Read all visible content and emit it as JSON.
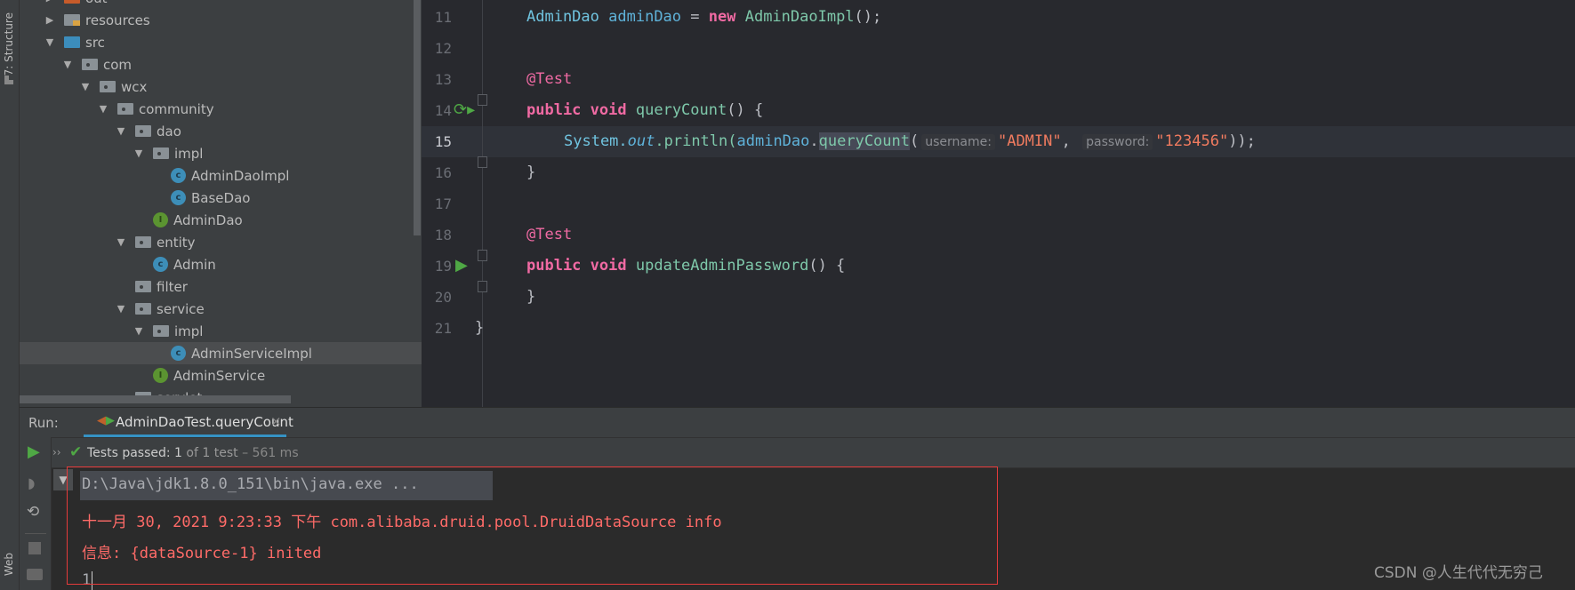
{
  "left_stripe": {
    "structure": "7: Structure",
    "web": "Web"
  },
  "tree": {
    "items": [
      {
        "label": "out",
        "depth": 1,
        "arrow": "collapsed",
        "icon": "folder-out-icon"
      },
      {
        "label": "resources",
        "depth": 1,
        "arrow": "collapsed",
        "icon": "resources-folder-icon"
      },
      {
        "label": "src",
        "depth": 1,
        "arrow": "expanded",
        "icon": "source-folder-icon"
      },
      {
        "label": "com",
        "depth": 2,
        "arrow": "expanded",
        "icon": "package-icon"
      },
      {
        "label": "wcx",
        "depth": 3,
        "arrow": "expanded",
        "icon": "package-icon"
      },
      {
        "label": "community",
        "depth": 4,
        "arrow": "expanded",
        "icon": "package-icon"
      },
      {
        "label": "dao",
        "depth": 5,
        "arrow": "expanded",
        "icon": "package-icon"
      },
      {
        "label": "impl",
        "depth": 6,
        "arrow": "expanded",
        "icon": "package-icon"
      },
      {
        "label": "AdminDaoImpl",
        "depth": 7,
        "arrow": "none",
        "icon": "class-icon"
      },
      {
        "label": "BaseDao",
        "depth": 7,
        "arrow": "none",
        "icon": "abstract-class-icon"
      },
      {
        "label": "AdminDao",
        "depth": 6,
        "arrow": "none",
        "icon": "interface-icon"
      },
      {
        "label": "entity",
        "depth": 5,
        "arrow": "expanded",
        "icon": "package-icon"
      },
      {
        "label": "Admin",
        "depth": 6,
        "arrow": "none",
        "icon": "class-icon"
      },
      {
        "label": "filter",
        "depth": 5,
        "arrow": "none",
        "icon": "package-icon"
      },
      {
        "label": "service",
        "depth": 5,
        "arrow": "expanded",
        "icon": "package-icon"
      },
      {
        "label": "impl",
        "depth": 6,
        "arrow": "expanded",
        "icon": "package-icon"
      },
      {
        "label": "AdminServiceImpl",
        "depth": 7,
        "arrow": "none",
        "icon": "class-icon",
        "selected": true
      },
      {
        "label": "AdminService",
        "depth": 6,
        "arrow": "none",
        "icon": "interface-icon"
      },
      {
        "label": "servlet",
        "depth": 5,
        "arrow": "none",
        "icon": "package-icon"
      }
    ]
  },
  "editor": {
    "line_numbers": [
      "11",
      "12",
      "13",
      "14",
      "15",
      "16",
      "17",
      "18",
      "19",
      "20",
      "21"
    ],
    "current_line": "15",
    "l11": {
      "type": "AdminDao",
      "var": "adminDao",
      "eq": " = ",
      "kw": "new",
      "ctor": "AdminDaoImpl",
      "end": "();"
    },
    "l13": "@Test",
    "l14": {
      "kw1": "public",
      "kw2": "void",
      "method": "queryCount",
      "end": "() {"
    },
    "l15": {
      "sys": "System.",
      "out": "out",
      "println": ".println(",
      "obj": "adminDao",
      "dot": ".",
      "method": "queryCount",
      "paren": "(",
      "hint1": "username:",
      "arg1": "\"ADMIN\"",
      "comma": ", ",
      "hint2": "password:",
      "arg2": "\"123456\"",
      "end": "));"
    },
    "l16": "}",
    "l18": "@Test",
    "l19": {
      "kw1": "public",
      "kw2": "void",
      "method": "updateAdminPassword",
      "end": "() {"
    },
    "l20": "}",
    "l21": "}"
  },
  "run": {
    "label": "Run:",
    "tab": "AdminDaoTest.queryCount",
    "status_prefix": "Tests passed:",
    "status_count": "1",
    "status_of": "of 1 test",
    "status_time": "– 561 ms"
  },
  "console": {
    "lines": [
      "D:\\Java\\jdk1.8.0_151\\bin\\java.exe ...",
      "十一月 30, 2021 9:23:33 下午 com.alibaba.druid.pool.DruidDataSource info",
      "信息: {dataSource-1} inited",
      "1"
    ]
  },
  "watermark": "CSDN @人生代代无穷己",
  "colors": {
    "keyword": "#f06aa3",
    "string": "#f07b5f",
    "error_text": "#ff6b68",
    "pass": "#4fa845",
    "accent": "#3592c4"
  }
}
